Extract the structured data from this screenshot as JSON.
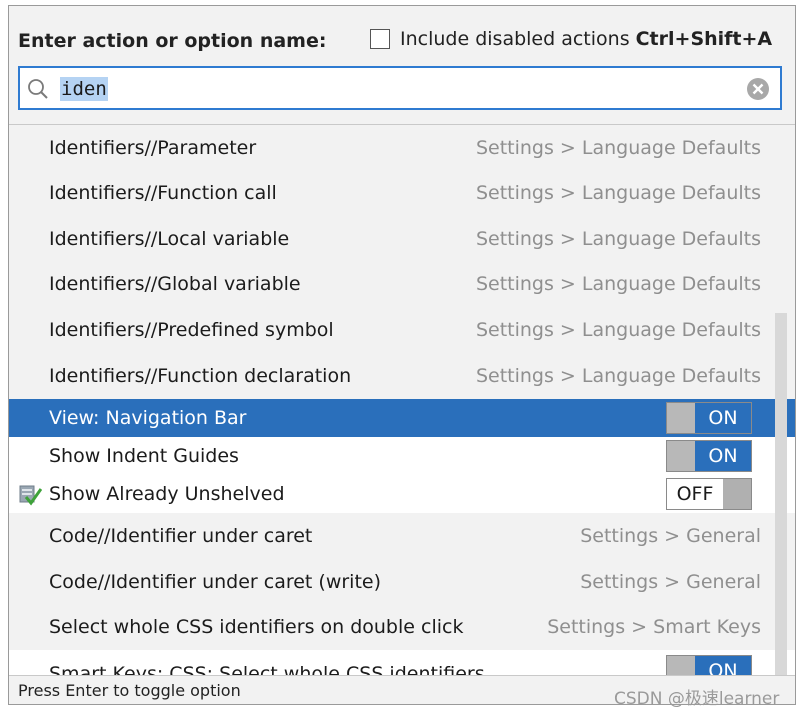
{
  "header": {
    "prompt_label": "Enter action or option name:",
    "include_disabled_label": "Include disabled actions",
    "include_disabled_shortcut": "Ctrl+Shift+A",
    "include_disabled_checked": false
  },
  "search": {
    "value": "iden",
    "search_icon": "search-icon",
    "clear_icon": "clear-icon"
  },
  "results": [
    {
      "kind": "setting",
      "name": "Identifiers//Parameter",
      "path": "Settings > Language Defaults"
    },
    {
      "kind": "setting",
      "name": "Identifiers//Function call",
      "path": "Settings > Language Defaults"
    },
    {
      "kind": "setting",
      "name": "Identifiers//Local variable",
      "path": "Settings > Language Defaults"
    },
    {
      "kind": "setting",
      "name": "Identifiers//Global variable",
      "path": "Settings > Language Defaults"
    },
    {
      "kind": "setting",
      "name": "Identifiers//Predefined symbol",
      "path": "Settings > Language Defaults"
    },
    {
      "kind": "setting",
      "name": "Identifiers//Function declaration",
      "path": "Settings > Language Defaults"
    },
    {
      "kind": "option",
      "name": "View: Navigation Bar",
      "toggle": "ON",
      "selected": true
    },
    {
      "kind": "option",
      "name": "Show Indent Guides",
      "toggle": "ON"
    },
    {
      "kind": "option",
      "name": "Show Already Unshelved",
      "toggle": "OFF",
      "icon": "unshelve-icon"
    },
    {
      "kind": "setting",
      "name": "Code//Identifier under caret",
      "path": "Settings > General"
    },
    {
      "kind": "setting",
      "name": "Code//Identifier under caret (write)",
      "path": "Settings > General"
    },
    {
      "kind": "setting",
      "name": "Select whole CSS identifiers on double click",
      "path": "Settings > Smart Keys"
    },
    {
      "kind": "option",
      "name": "Smart Keys: CSS: Select whole CSS identifiers",
      "toggle": "ON"
    }
  ],
  "status": {
    "hint": "Press Enter to toggle option"
  },
  "watermark": "CSDN @极速learner",
  "colors": {
    "accent": "#2a6fbb",
    "selection_text_bg": "#b5d3f3",
    "search_border": "#2f7bd1",
    "settings_row_bg": "#f2f2f2",
    "path_text": "#8f8f8f"
  }
}
